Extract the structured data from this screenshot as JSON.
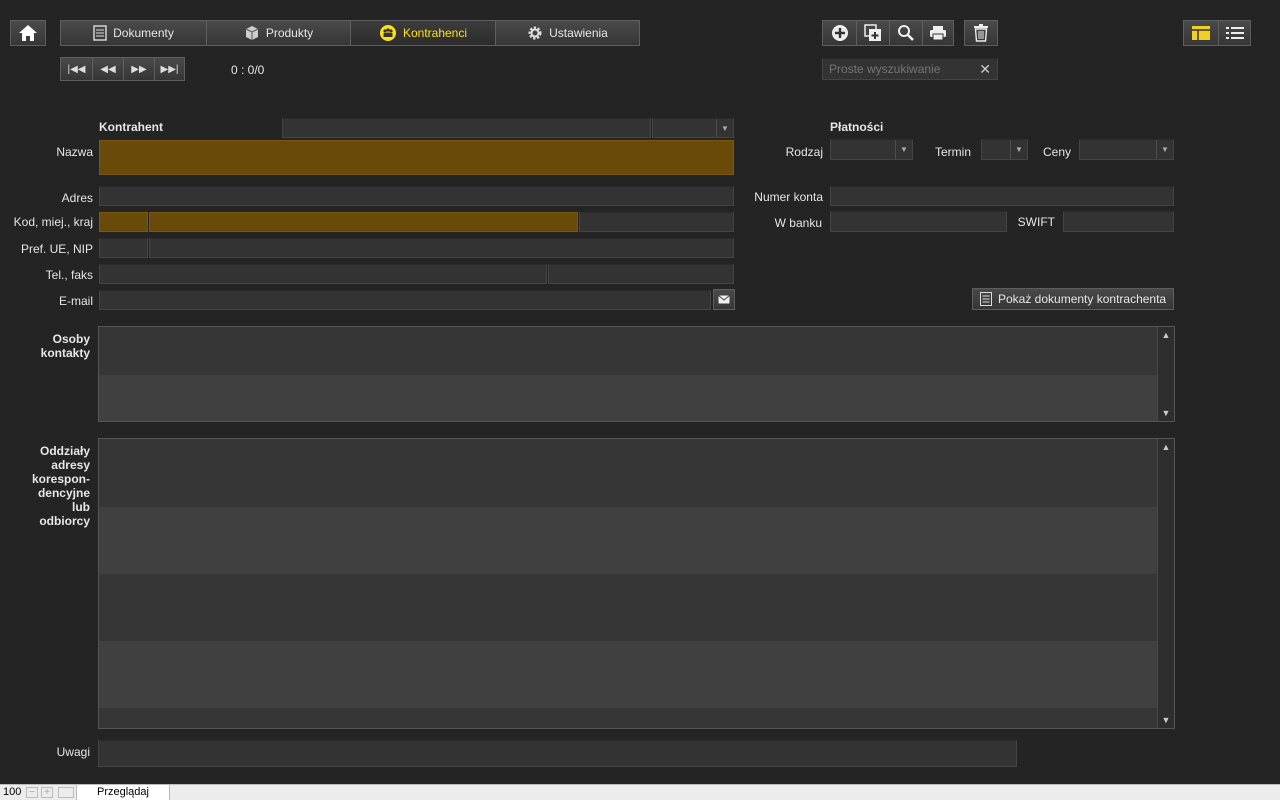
{
  "nav": {
    "tabs": [
      {
        "label": "Dokumenty",
        "icon": "document-icon"
      },
      {
        "label": "Produkty",
        "icon": "box-icon"
      },
      {
        "label": "Kontrahenci",
        "icon": "contacts-icon",
        "active": true
      },
      {
        "label": "Ustawienia",
        "icon": "gear-icon"
      }
    ],
    "record_counter": "0 : 0/0"
  },
  "search": {
    "placeholder": "Proste wyszukiwanie"
  },
  "form": {
    "section_contractor": "Kontrahent",
    "name_label": "Nazwa",
    "address_label": "Adres",
    "postal_label": "Kod, miej., kraj",
    "vat_label": "Pref. UE, NIP",
    "phone_label": "Tel., faks",
    "email_label": "E-mail",
    "contacts_label_1": "Osoby",
    "contacts_label_2": "kontakty",
    "branches_label_lines": [
      "Oddziały",
      "adresy",
      "korespon-",
      "dencyjne",
      "lub",
      "odbiorcy"
    ],
    "notes_label": "Uwagi"
  },
  "payments": {
    "section_title": "Płatności",
    "type_label": "Rodzaj",
    "term_label": "Termin",
    "prices_label": "Ceny",
    "account_label": "Numer konta",
    "bank_label": "W banku",
    "swift_label": "SWIFT",
    "show_docs_button": "Pokaż dokumenty kontrachenta"
  },
  "statusbar": {
    "zoom": "100",
    "mode": "Przeglądaj"
  },
  "colors": {
    "background": "#242424",
    "highlight_field": "#6a4a08",
    "active_tab_text": "#ffe01a",
    "active_view": "#f0d020"
  }
}
